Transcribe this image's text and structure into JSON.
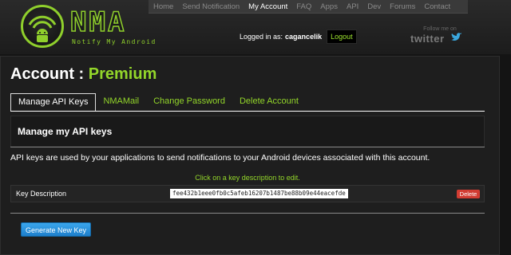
{
  "brand": {
    "name": "NMA",
    "tagline": "Notify My Android",
    "logo_icon": "android-wifi-icon",
    "accent_color": "#93d62a"
  },
  "nav": {
    "items": [
      {
        "label": "Home"
      },
      {
        "label": "Send Notification"
      },
      {
        "label": "My Account",
        "active": true
      },
      {
        "label": "FAQ"
      },
      {
        "label": "Apps"
      },
      {
        "label": "API"
      },
      {
        "label": "Dev"
      },
      {
        "label": "Forums"
      },
      {
        "label": "Contact"
      }
    ]
  },
  "session": {
    "logged_in_prefix": "Logged in as:",
    "username": "cagancelik",
    "logout_label": "Logout"
  },
  "social": {
    "follow_text": "Follow me on",
    "twitter_label": "twitter",
    "icon": "twitter-bird-icon"
  },
  "page": {
    "title_prefix": "Account :",
    "plan": "Premium"
  },
  "tabs": [
    {
      "label": "Manage API Keys",
      "active": true
    },
    {
      "label": "NMAMail"
    },
    {
      "label": "Change Password"
    },
    {
      "label": "Delete Account"
    }
  ],
  "api_keys": {
    "section_title": "Manage my API keys",
    "description": "API keys are used by your applications to send notifications to your Android devices associated with this account.",
    "hint": "Click on a key description to edit.",
    "rows": [
      {
        "description": "Key Description",
        "key": "fee432b1eee0fb0c5afeb16207b1487be88b09e44eacefde",
        "delete_label": "Delete"
      }
    ],
    "generate_label": "Generate New Key"
  }
}
